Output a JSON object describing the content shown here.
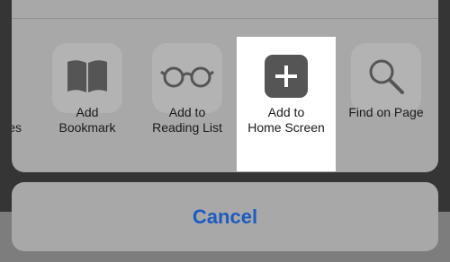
{
  "share_sheet": {
    "actions": [
      {
        "label": "es",
        "icon": "partial-icon"
      },
      {
        "label": "Add\nBookmark",
        "icon": "book-icon"
      },
      {
        "label": "Add to\nReading List",
        "icon": "glasses-icon"
      },
      {
        "label": "Add to\nHome Screen",
        "icon": "plus-square-icon",
        "highlighted": true
      },
      {
        "label": "Find on Page",
        "icon": "search-icon"
      }
    ]
  },
  "cancel": {
    "label": "Cancel"
  },
  "colors": {
    "accent": "#1c5bbf",
    "icon": "#555555"
  }
}
